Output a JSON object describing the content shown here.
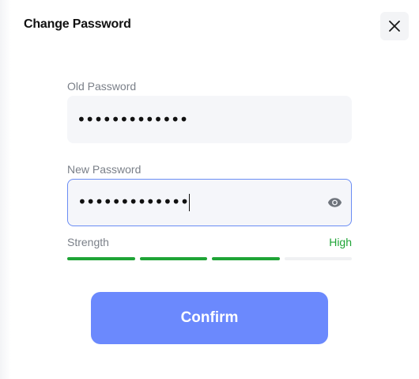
{
  "dialog": {
    "title": "Change Password"
  },
  "old_password": {
    "label": "Old Password",
    "value": "•••••••••••••"
  },
  "new_password": {
    "label": "New Password",
    "value": "•••••••••••••"
  },
  "strength": {
    "label": "Strength",
    "level": "High",
    "filled_segments": 3,
    "total_segments": 4
  },
  "confirm": {
    "label": "Confirm"
  },
  "colors": {
    "accent": "#6b89fd",
    "success": "#1fa436",
    "focus_border": "#6a8cf4"
  },
  "icons": {
    "close": "close-icon",
    "eye": "eye-icon"
  }
}
